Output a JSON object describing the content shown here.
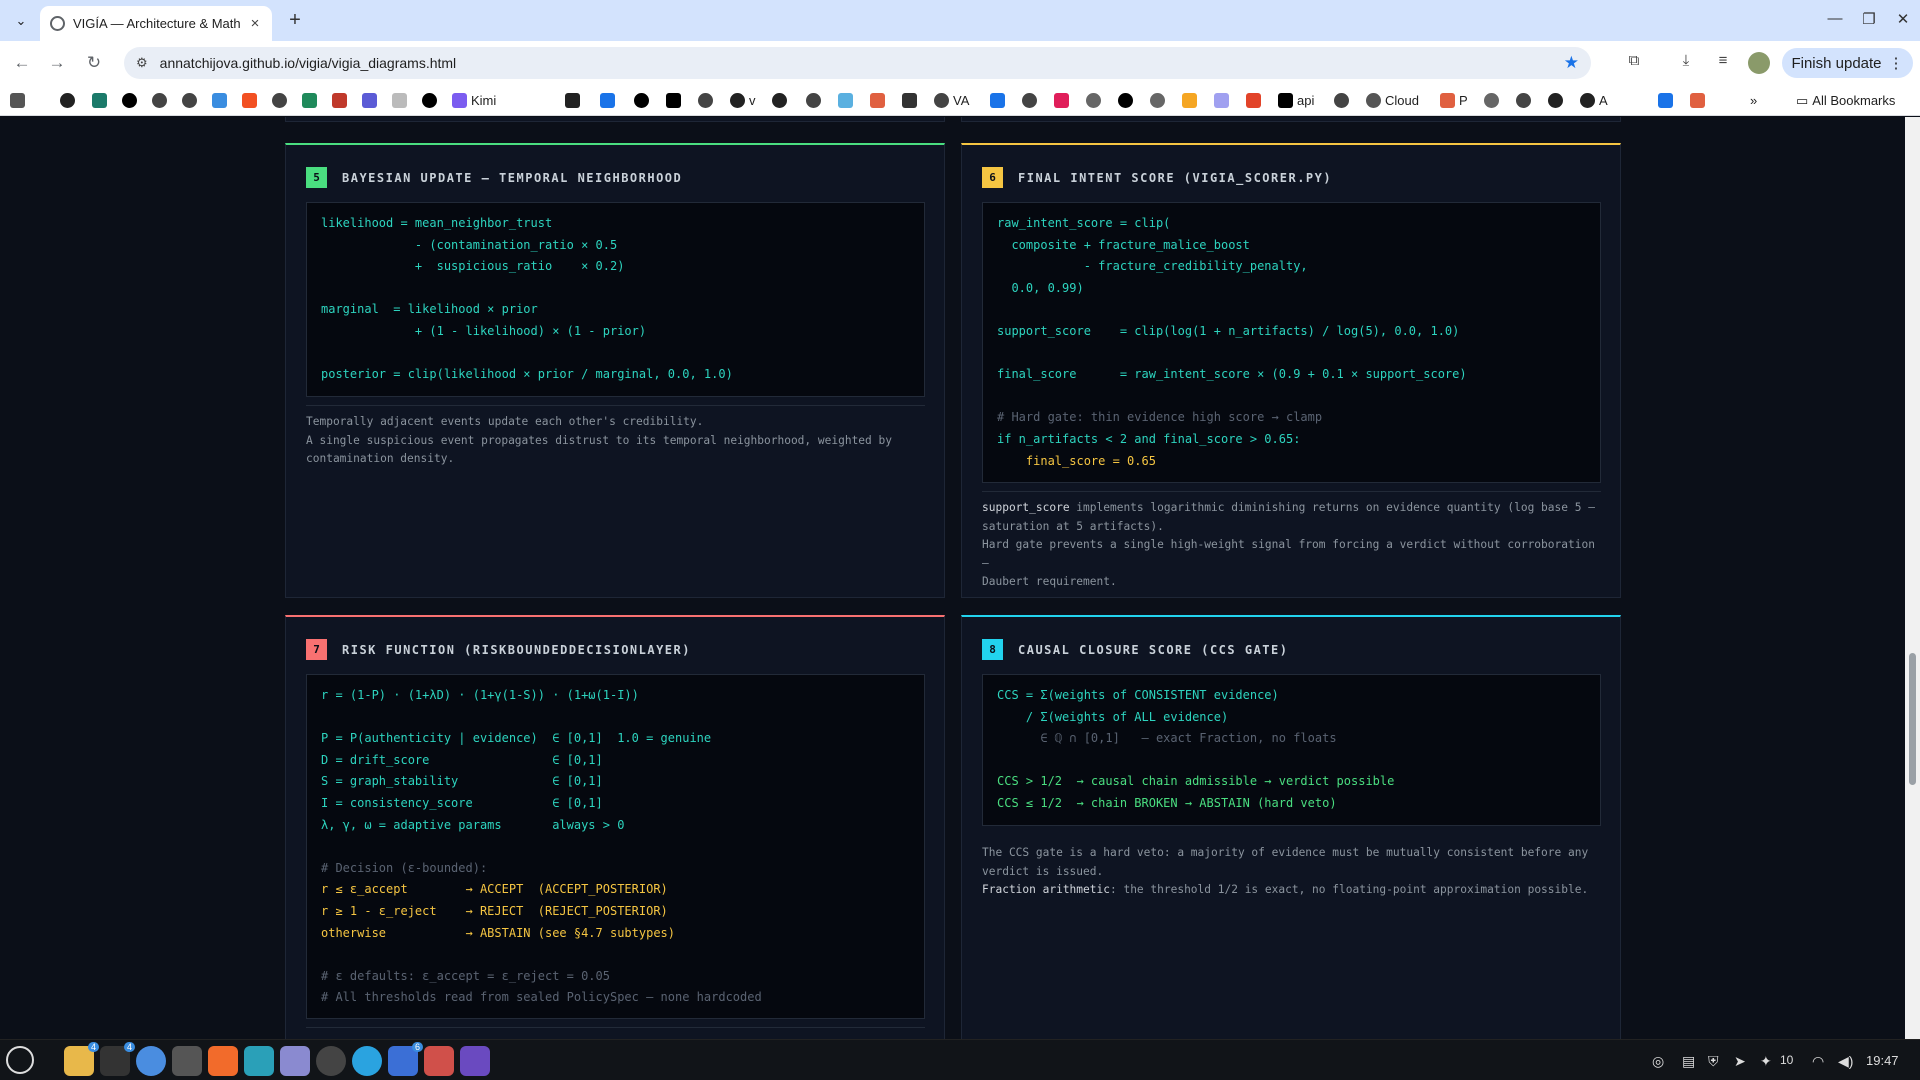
{
  "browser": {
    "tab_title": "VIGÍA — Architecture & Math",
    "url": "annatchijova.github.io/vigia/vigia_diagrams.html",
    "finish_update": "Finish update",
    "bookmarks": [
      "Kimi",
      "v",
      "VA",
      "api",
      "Cloud",
      "P",
      "A"
    ],
    "all_bookmarks": "All Bookmarks"
  },
  "panels": {
    "p5": {
      "num": "5",
      "title": "BAYESIAN UPDATE — TEMPORAL NEIGHBORHOOD",
      "accent": "#4ade80",
      "code": [
        "likelihood = mean_neighbor_trust",
        "             - (contamination_ratio × 0.5",
        "             +  suspicious_ratio    × 0.2)",
        "",
        "marginal  = likelihood × prior",
        "             + (1 - likelihood) × (1 - prior)",
        "",
        "posterior = clip(likelihood × prior / marginal, 0.0, 1.0)"
      ],
      "desc": [
        "Temporally adjacent events update each other's credibility.",
        "A single suspicious event propagates distrust to its temporal neighborhood, weighted by",
        "contamination density."
      ]
    },
    "p6": {
      "num": "6",
      "title": "FINAL INTENT SCORE (VIGIA_SCORER.PY)",
      "accent": "#f5c542",
      "code": [
        "raw_intent_score = clip(",
        "  composite + fracture_malice_boost",
        "            - fracture_credibility_penalty,",
        "  0.0, 0.99)",
        "",
        "support_score    = clip(log(1 + n_artifacts) / log(5), 0.0, 1.0)",
        "",
        "final_score      = raw_intent_score × (0.9 + 0.1 × support_score)",
        "",
        "# Hard gate: thin evidence high score → clamp",
        "if n_artifacts < 2 and final_score > 0.65:",
        "    final_score = 0.65"
      ],
      "desc_key": "support_score",
      "desc1": " implements logarithmic diminishing returns on evidence quantity (log base 5 —",
      "desc2": "saturation at 5 artifacts).",
      "desc3": "Hard gate prevents a single high-weight signal from forcing a verdict without corroboration —",
      "desc4": "Daubert requirement."
    },
    "p7": {
      "num": "7",
      "title": "RISK FUNCTION (RISKBOUNDEDDECISIONLAYER)",
      "accent": "#f87171",
      "code": [
        "r = (1-P) · (1+λD) · (1+γ(1-S)) · (1+ω(1-I))",
        "",
        "P = P(authenticity | evidence)  ∈ [0,1]  1.0 = genuine",
        "D = drift_score                 ∈ [0,1]",
        "S = graph_stability             ∈ [0,1]",
        "I = consistency_score           ∈ [0,1]",
        "λ, γ, ω = adaptive params       always > 0",
        "",
        "# Decision (ε-bounded):",
        "r ≤ ε_accept        → ACCEPT  (ACCEPT_POSTERIOR)",
        "r ≥ 1 - ε_reject    → REJECT  (REJECT_POSTERIOR)",
        "otherwise           → ABSTAIN (see §4.7 subtypes)",
        "",
        "# ε defaults: ε_accept = ε_reject = 0.05",
        "# All thresholds read from sealed PolicySpec — none hardcoded"
      ]
    },
    "p8": {
      "num": "8",
      "title": "CAUSAL CLOSURE SCORE (CCS GATE)",
      "accent": "#22d3ee",
      "code": [
        "CCS = Σ(weights of CONSISTENT evidence)",
        "    / Σ(weights of ALL evidence)",
        "      ∈ ℚ ∩ [0,1]   — exact Fraction, no floats",
        "",
        "CCS > 1/2  → causal chain admissible → verdict possible",
        "CCS ≤ 1/2  → chain BROKEN → ABSTAIN (hard veto)"
      ],
      "desc1": "The CCS gate is a hard veto: a majority of evidence must be mutually consistent before any",
      "desc2": "verdict is issued.",
      "desc_key": "Fraction arithmetic",
      "desc3": ": the threshold 1/2 is exact, no floating-point approximation possible."
    }
  },
  "taskbar": {
    "badges": [
      "4",
      "4",
      "6"
    ],
    "tray_count": "10",
    "time": "19:47"
  }
}
